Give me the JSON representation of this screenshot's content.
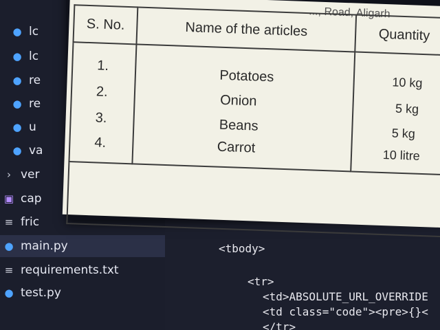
{
  "sidebar": {
    "items": [
      {
        "icon": "python-file-icon",
        "label": "lc"
      },
      {
        "icon": "python-file-icon",
        "label": "lc"
      },
      {
        "icon": "python-file-icon",
        "label": "re"
      },
      {
        "icon": "python-file-icon",
        "label": "re"
      },
      {
        "icon": "python-file-icon",
        "label": "u"
      },
      {
        "icon": "python-file-icon",
        "label": "va"
      },
      {
        "icon": "chevron-right-icon",
        "label": "ver"
      },
      {
        "icon": "image-file-icon",
        "label": "cap"
      },
      {
        "icon": "text-file-icon",
        "label": "fric"
      },
      {
        "icon": "python-file-icon",
        "label": "main.py",
        "active": true
      },
      {
        "icon": "text-file-icon",
        "label": "requirements.txt"
      },
      {
        "icon": "python-file-icon",
        "label": "test.py"
      }
    ]
  },
  "editor": {
    "lines": [
      {
        "text": "<tbody>"
      },
      {
        "text": "<tr>"
      },
      {
        "text": "<td>ABSOLUTE_URL_OVERRIDE"
      },
      {
        "text": "<td class=\"code\"><pre>{}<"
      },
      {
        "text": "</tr>"
      }
    ]
  },
  "preview": {
    "header_text": "..., Road, Aligarh",
    "table": {
      "headers": [
        "S. No.",
        "Name of the articles",
        "Quantity"
      ],
      "rows": [
        {
          "sno": "1.",
          "name": "Potatoes",
          "qty": "10 kg"
        },
        {
          "sno": "2.",
          "name": "Onion",
          "qty": "5 kg"
        },
        {
          "sno": "3.",
          "name": "Beans",
          "qty": "5 kg"
        },
        {
          "sno": "4.",
          "name": "Carrot",
          "qty": "10 litre"
        }
      ]
    }
  },
  "colors": {
    "editor_bg": "#1c1f2d",
    "sidebar_bg": "#1b1e2c",
    "active_row": "#2b3047",
    "python_icon": "#4ea3ff",
    "paper": "#f2f1e6"
  }
}
